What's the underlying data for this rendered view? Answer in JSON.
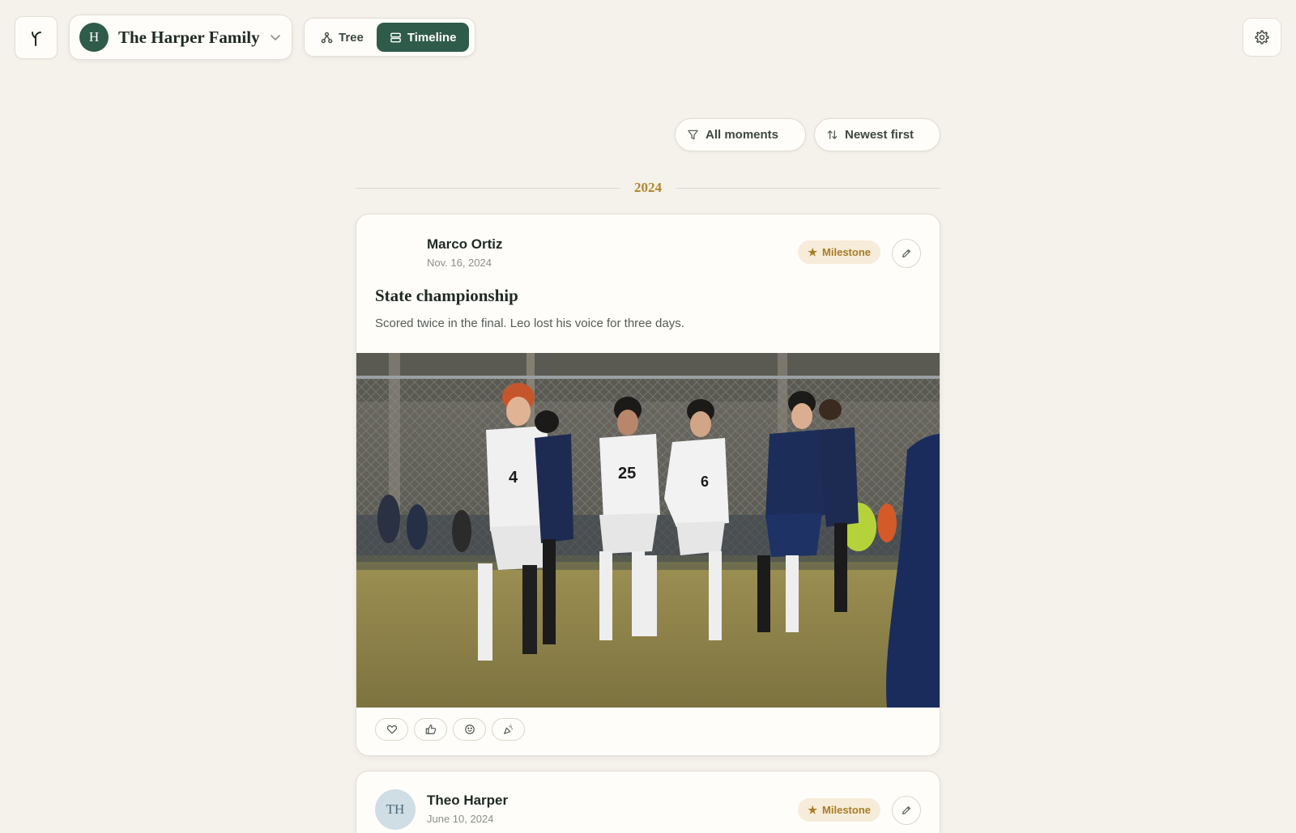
{
  "header": {
    "family_initial": "H",
    "family_name": "The Harper Family",
    "views": [
      {
        "label": "Tree",
        "active": false
      },
      {
        "label": "Timeline",
        "active": true
      }
    ]
  },
  "filters": {
    "moments_label": "All moments",
    "sort_label": "Newest first"
  },
  "timeline": {
    "year": "2024",
    "posts": [
      {
        "author": "Marco Ortiz",
        "date": "Nov. 16, 2024",
        "badge": "Milestone",
        "title": "State championship",
        "body": "Scored twice in the final. Leo lost his voice for three days."
      },
      {
        "author": "Theo Harper",
        "author_initials": "TH",
        "date": "June 10, 2024",
        "badge": "Milestone"
      }
    ]
  },
  "colors": {
    "background": "#f5f1eb",
    "primary": "#2f5b4a",
    "accent_gold": "#b0872f",
    "badge_bg": "#f6ecd9"
  },
  "icons": {
    "logo": "sprout-icon",
    "tree": "tree-nodes-icon",
    "timeline": "timeline-list-icon",
    "settings": "gear-icon",
    "filter": "filter-funnel-icon",
    "sort": "sort-arrows-icon",
    "milestone": "star-icon",
    "edit": "pencil-icon",
    "reactions": [
      "heart-icon",
      "thumbs-up-icon",
      "smile-icon",
      "party-popper-icon"
    ]
  }
}
